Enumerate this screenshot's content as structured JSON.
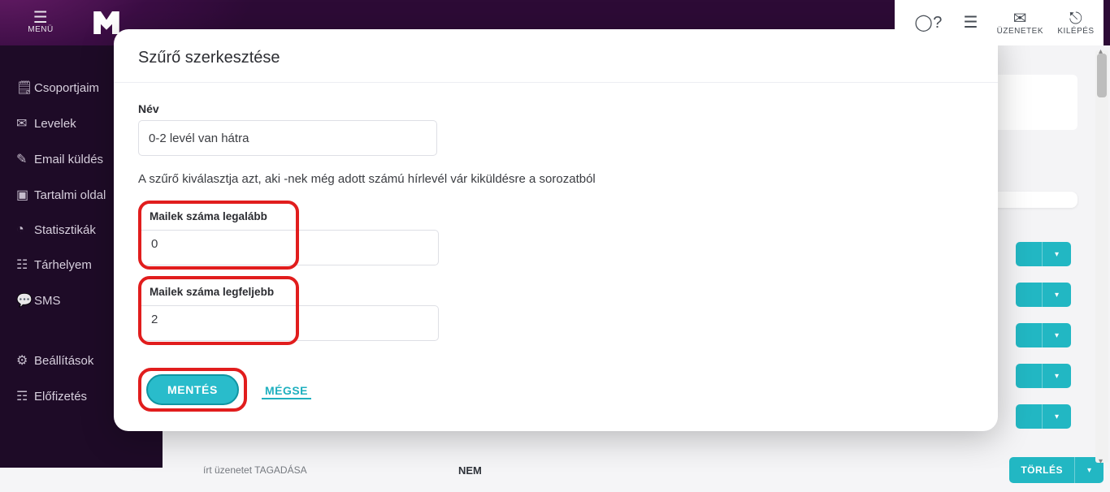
{
  "topbar": {
    "menu_label": "MENÜ",
    "right": [
      {
        "icon": "help",
        "label": ""
      },
      {
        "icon": "form",
        "label": ""
      },
      {
        "icon": "mail",
        "label": "ÜZENETEK"
      },
      {
        "icon": "logout",
        "label": "KILÉPÉS"
      }
    ]
  },
  "sidebar": {
    "items": [
      {
        "icon": "clipboard",
        "label": "Csoportjaim"
      },
      {
        "icon": "mail",
        "label": "Levelek"
      },
      {
        "icon": "edit",
        "label": "Email küldés"
      },
      {
        "icon": "book",
        "label": "Tartalmi oldal"
      },
      {
        "icon": "pie",
        "label": "Statisztikák"
      },
      {
        "icon": "storage",
        "label": "Tárhelyem"
      },
      {
        "icon": "sms",
        "label": "SMS"
      },
      {
        "icon": "gear",
        "label": "Beállítások",
        "space": true
      },
      {
        "icon": "card",
        "label": "Előfizetés"
      }
    ]
  },
  "background": {
    "delete_label": "TÖRLÉS",
    "row_left": "írt üzenetet TAGADÁSA",
    "row_mid": "NEM"
  },
  "modal": {
    "title": "Szűrő szerkesztése",
    "name_label": "Név",
    "name_value": "0-2 levél van hátra",
    "description": "A szűrő kiválasztja azt, aki -nek még adott számú hírlevél vár kiküldésre a sorozatból",
    "min_label": "Mailek száma legalább",
    "min_value": "0",
    "max_label": "Mailek száma legfeljebb",
    "max_value": "2",
    "save_label": "MENTÉS",
    "cancel_label": "MÉGSE"
  }
}
